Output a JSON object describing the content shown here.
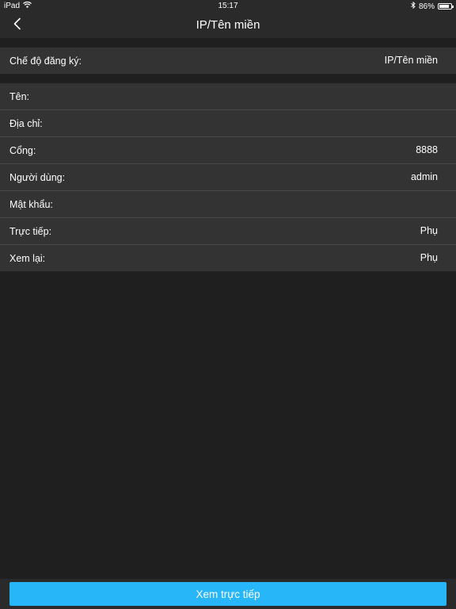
{
  "status_bar": {
    "device": "iPad",
    "time": "15:17",
    "battery": "86%",
    "battery_level": 0.86,
    "icons": [
      "wifi-icon",
      "bluetooth-icon",
      "battery-icon"
    ]
  },
  "nav": {
    "title": "IP/Tên miền",
    "back_icon": "chevron-left-icon"
  },
  "registration": {
    "label": "Chế độ đăng ký:",
    "value": "IP/Tên miền"
  },
  "fields": [
    {
      "label": "Tên:",
      "value": ""
    },
    {
      "label": "Địa chỉ:",
      "value": ""
    },
    {
      "label": "Cổng:",
      "value": "8888"
    },
    {
      "label": "Người dùng:",
      "value": "admin"
    },
    {
      "label": "Mật khẩu:",
      "value": ""
    },
    {
      "label": "Trực tiếp:",
      "value": "Phụ"
    },
    {
      "label": "Xem lại:",
      "value": "Phụ"
    }
  ],
  "bottom": {
    "button_label": "Xem trực tiếp"
  },
  "colors": {
    "background": "#1f1f1f",
    "bar": "#2a2a2a",
    "row": "#333333",
    "accent": "#27b6f8"
  }
}
